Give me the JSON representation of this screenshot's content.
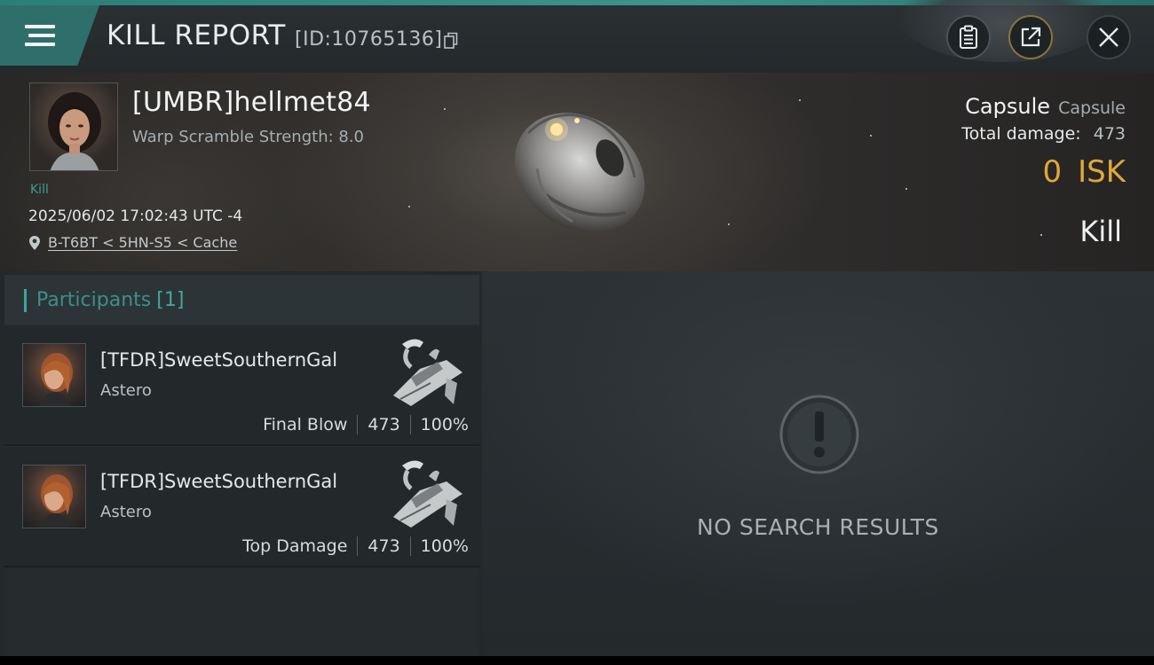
{
  "header": {
    "title": "KILL REPORT",
    "report_id": "[ID:10765136]"
  },
  "victim": {
    "name": "[UMBR]hellmet84",
    "warp_scramble": "Warp Scramble Strength: 8.0",
    "tag": "Kill",
    "datetime": "2025/06/02 17:02:43 UTC -4",
    "location": "B-T6BT < 5HN-S5 < Cache",
    "ship_name": "Capsule",
    "ship_class": "Capsule",
    "total_damage_label": "Total damage:",
    "total_damage_value": "473",
    "isk_value": "0",
    "isk_unit": "ISK",
    "status": "Kill"
  },
  "participants": {
    "title": "Participants",
    "count": "[1]",
    "rows": [
      {
        "name": "[TFDR]SweetSouthernGal",
        "ship": "Astero",
        "label": "Final Blow",
        "damage": "473",
        "percent": "100%"
      },
      {
        "name": "[TFDR]SweetSouthernGal",
        "ship": "Astero",
        "label": "Top Damage",
        "damage": "473",
        "percent": "100%"
      }
    ]
  },
  "results": {
    "empty_text": "NO SEARCH RESULTS"
  },
  "icons": {
    "menu": "menu-icon",
    "copy": "copy-icon",
    "clipboard": "clipboard-icon",
    "share": "share-icon",
    "close": "close-icon",
    "location": "location-pin-icon",
    "alert": "exclamation-circle-icon"
  },
  "colors": {
    "accent_teal": "#3ea59a",
    "isk_gold": "#e0a83a",
    "share_ring": "#8a7440"
  }
}
